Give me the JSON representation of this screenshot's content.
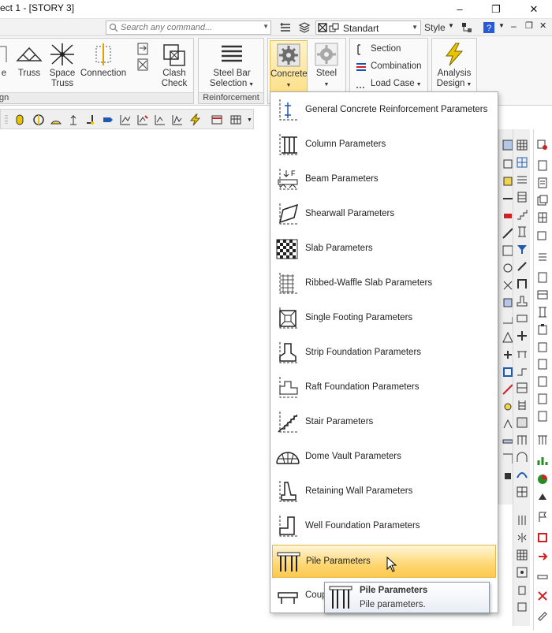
{
  "window": {
    "title": "ect 1 - [STORY 3]",
    "minimize": "–",
    "restore": "❐",
    "close": "✕"
  },
  "commandbar": {
    "search_placeholder": "Search any command...",
    "style_value": "Standart",
    "style_label": "Style"
  },
  "ribbon": {
    "groups": [
      {
        "label": "gn"
      },
      {
        "label": "Reinforcement"
      }
    ],
    "buttons": {
      "e_partial": "e",
      "truss": "Truss",
      "space_truss_1": "Space",
      "space_truss_2": "Truss",
      "connection": "Connection",
      "clash_check_1": "Clash",
      "clash_check_2": "Check",
      "steel_bar_1": "Steel Bar",
      "steel_bar_2": "Selection",
      "concrete": "Concrete",
      "steel": "Steel",
      "section": "Section",
      "combination": "Combination",
      "load_case": "Load Case",
      "analysis_1": "Analysis",
      "analysis_2": "Design"
    }
  },
  "menu": {
    "items": [
      {
        "label": "General Concrete Reinforcement Parameters",
        "icon": "general-reinforcement-icon"
      },
      {
        "label": "Column Parameters",
        "icon": "column-icon"
      },
      {
        "label": "Beam Parameters",
        "icon": "beam-icon"
      },
      {
        "label": "Shearwall Parameters",
        "icon": "shearwall-icon"
      },
      {
        "label": "Slab Parameters",
        "icon": "slab-icon"
      },
      {
        "label": "Ribbed-Waffle Slab Parameters",
        "icon": "ribbed-slab-icon"
      },
      {
        "label": "Single Footing Parameters",
        "icon": "single-footing-icon"
      },
      {
        "label": "Strip Foundation Parameters",
        "icon": "strip-foundation-icon"
      },
      {
        "label": "Raft Foundation Parameters",
        "icon": "raft-foundation-icon"
      },
      {
        "label": "Stair Parameters",
        "icon": "stair-icon"
      },
      {
        "label": "Dome Vault Parameters",
        "icon": "dome-vault-icon"
      },
      {
        "label": "Retaining Wall Parameters",
        "icon": "retaining-wall-icon"
      },
      {
        "label": "Well Foundation Parameters",
        "icon": "well-foundation-icon"
      },
      {
        "label": "Pile Parameters",
        "icon": "pile-icon"
      },
      {
        "label": "Coup",
        "icon": "coupling-beam-icon"
      }
    ]
  },
  "tooltip": {
    "title": "Pile Parameters",
    "description": "Pile parameters."
  },
  "colors": {
    "accent_hover": "#fdd773",
    "active_button": "#fde08a",
    "help_blue": "#2a5bd7"
  }
}
